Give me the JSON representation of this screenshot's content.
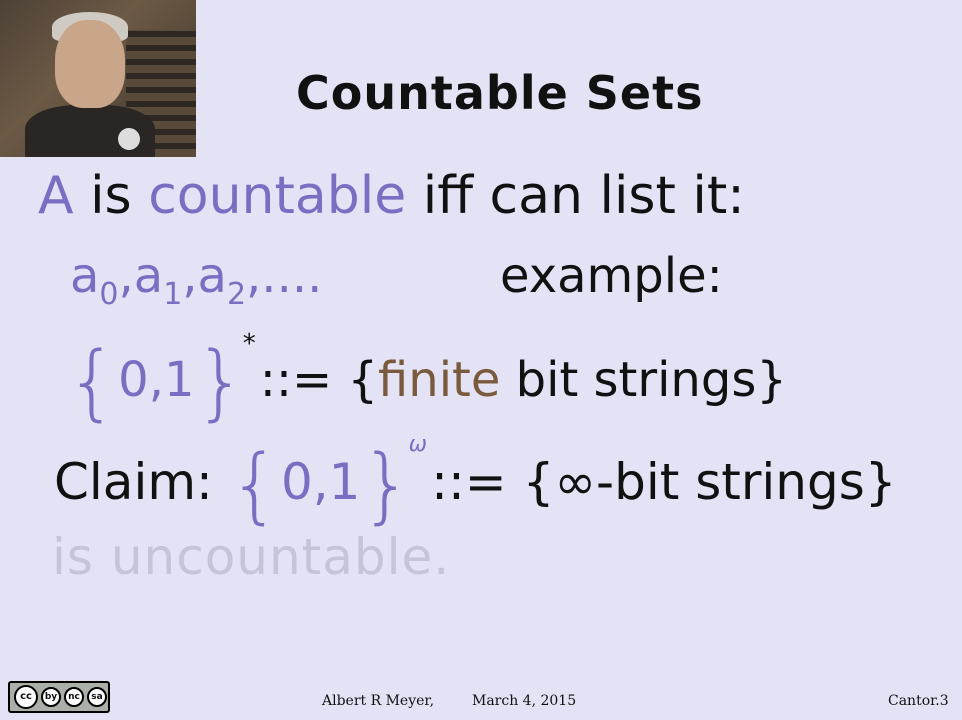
{
  "slide": {
    "title": "Countable Sets",
    "line1": {
      "a": "A",
      "is": " is ",
      "countable": "countable",
      "rest": " iff can list it:"
    },
    "line2": {
      "seq": [
        "a",
        "0",
        ",a",
        "1",
        ",a",
        "2",
        ",...."
      ],
      "example": "example:"
    },
    "line3": {
      "set": "0,1",
      "star": "*",
      "def": "::= {",
      "finite": "finite",
      "rest": " bit strings}"
    },
    "line4": {
      "claim": "Claim: ",
      "set": "0,1",
      "omega": "ω",
      "def": "::= {∞-bit strings}"
    },
    "line5": "is uncountable."
  },
  "footer": {
    "author": "Albert R Meyer,",
    "date": "March 4, 2015",
    "slide_id": "Cantor.3",
    "license_icons": [
      "cc",
      "by",
      "nc",
      "sa"
    ]
  }
}
